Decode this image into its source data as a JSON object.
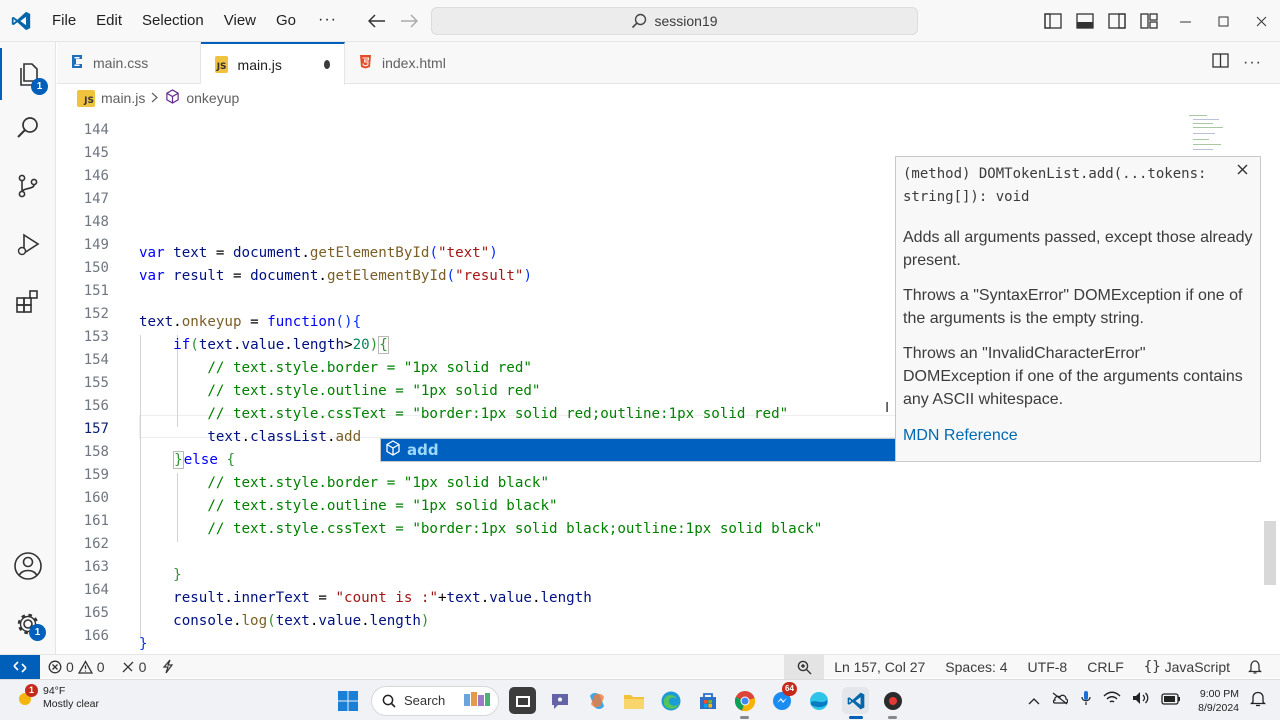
{
  "titlebar": {
    "menu": [
      "File",
      "Edit",
      "Selection",
      "View",
      "Go"
    ],
    "more": "···",
    "command_center": "session19"
  },
  "activity": {
    "explorer_badge": "1",
    "settings_badge": "1"
  },
  "tabs": [
    {
      "label": "main.css",
      "icon": "css-file-icon"
    },
    {
      "label": "main.js",
      "icon": "js-file-icon",
      "active": true,
      "dirty": true
    },
    {
      "label": "index.html",
      "icon": "html-file-icon"
    }
  ],
  "breadcrumbs": {
    "file": "main.js",
    "symbol": "onkeyup"
  },
  "editor": {
    "line_numbers": [
      "144",
      "145",
      "146",
      "147",
      "148",
      "149",
      "150",
      "151",
      "152",
      "153",
      "154",
      "155",
      "156",
      "157",
      "158",
      "159",
      "160",
      "161",
      "162",
      "163",
      "164",
      "165",
      "166"
    ],
    "current_line": "157"
  },
  "suggest": {
    "label": "add"
  },
  "docs": {
    "signature": "(method) DOMTokenList.add(...tokens: string[]): void",
    "p1": "Adds all arguments passed, except those already present.",
    "p2": "Throws a \"SyntaxError\" DOMException if one of the arguments is the empty string.",
    "p3": "Throws an \"InvalidCharacterError\" DOMException if one of the arguments contains any ASCII whitespace.",
    "link": "MDN Reference"
  },
  "status": {
    "errors": "0",
    "warnings": "0",
    "ports": "0",
    "position": "Ln 157, Col 27",
    "spaces": "Spaces: 4",
    "encoding": "UTF-8",
    "eol": "CRLF",
    "language": "JavaScript"
  },
  "taskbar": {
    "temp": "94°F",
    "weather": "Mostly clear",
    "weather_badge": "1",
    "search": "Search",
    "time": "9:00 PM",
    "date": "8/9/2024",
    "chrome_badge": "64"
  },
  "colors": {
    "accent": "#005fb8",
    "js_badge": "#f0c23d"
  }
}
